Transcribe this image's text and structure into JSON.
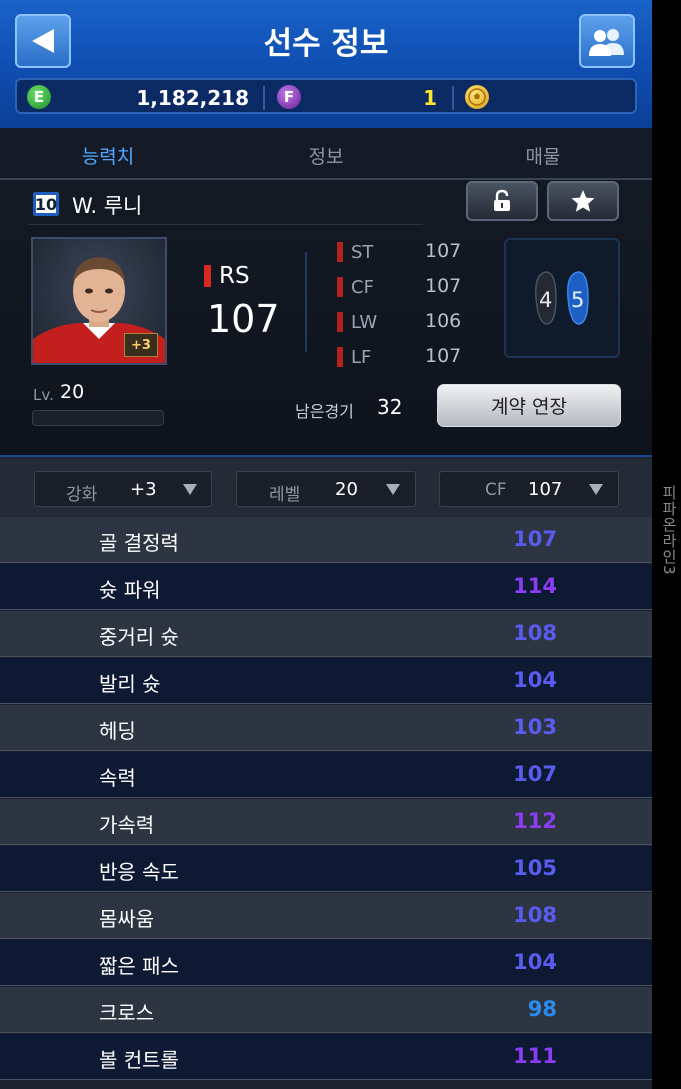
{
  "header": {
    "title": "선수 정보"
  },
  "currency": {
    "e_icon": "E",
    "e_amount": "1,182,218",
    "f_icon": "F",
    "f_amount": "1"
  },
  "tabs": [
    {
      "label": "능력치",
      "active": true
    },
    {
      "label": "정보",
      "active": false
    },
    {
      "label": "매물",
      "active": false
    }
  ],
  "player": {
    "number": "10",
    "name": "W. 루니",
    "enhance_badge": "+3",
    "main_position": "RS",
    "main_ovr": "107",
    "positions": [
      {
        "name": "ST",
        "value": "107"
      },
      {
        "name": "CF",
        "value": "107"
      },
      {
        "name": "LW",
        "value": "106"
      },
      {
        "name": "LF",
        "value": "107"
      }
    ],
    "weak_foot": "4",
    "strong_foot": "5",
    "level_label": "Lv.",
    "level": "20",
    "level_progress": 0,
    "remaining_label": "남은경기",
    "remaining": "32",
    "extend_button": "계약 연장"
  },
  "filters": [
    {
      "label": "강화",
      "value": "+3"
    },
    {
      "label": "레벨",
      "value": "20"
    },
    {
      "label": "CF",
      "value": "107"
    }
  ],
  "stats": [
    {
      "name": "골 결정력",
      "value": "107",
      "color": "#5a5cf0"
    },
    {
      "name": "슛 파워",
      "value": "114",
      "color": "#8b3cf4"
    },
    {
      "name": "중거리 슛",
      "value": "108",
      "color": "#5a5cf0"
    },
    {
      "name": "발리 슛",
      "value": "104",
      "color": "#5a5cf0"
    },
    {
      "name": "헤딩",
      "value": "103",
      "color": "#5a5cf0"
    },
    {
      "name": "속력",
      "value": "107",
      "color": "#5a5cf0"
    },
    {
      "name": "가속력",
      "value": "112",
      "color": "#8b3cf4"
    },
    {
      "name": "반응 속도",
      "value": "105",
      "color": "#5a5cf0"
    },
    {
      "name": "몸싸움",
      "value": "108",
      "color": "#5a5cf0"
    },
    {
      "name": "짧은 패스",
      "value": "104",
      "color": "#5a5cf0"
    },
    {
      "name": "크로스",
      "value": "98",
      "color": "#2a8cf0"
    },
    {
      "name": "볼 컨트롤",
      "value": "111",
      "color": "#8b3cf4"
    }
  ],
  "watermark": "피파온라인3"
}
